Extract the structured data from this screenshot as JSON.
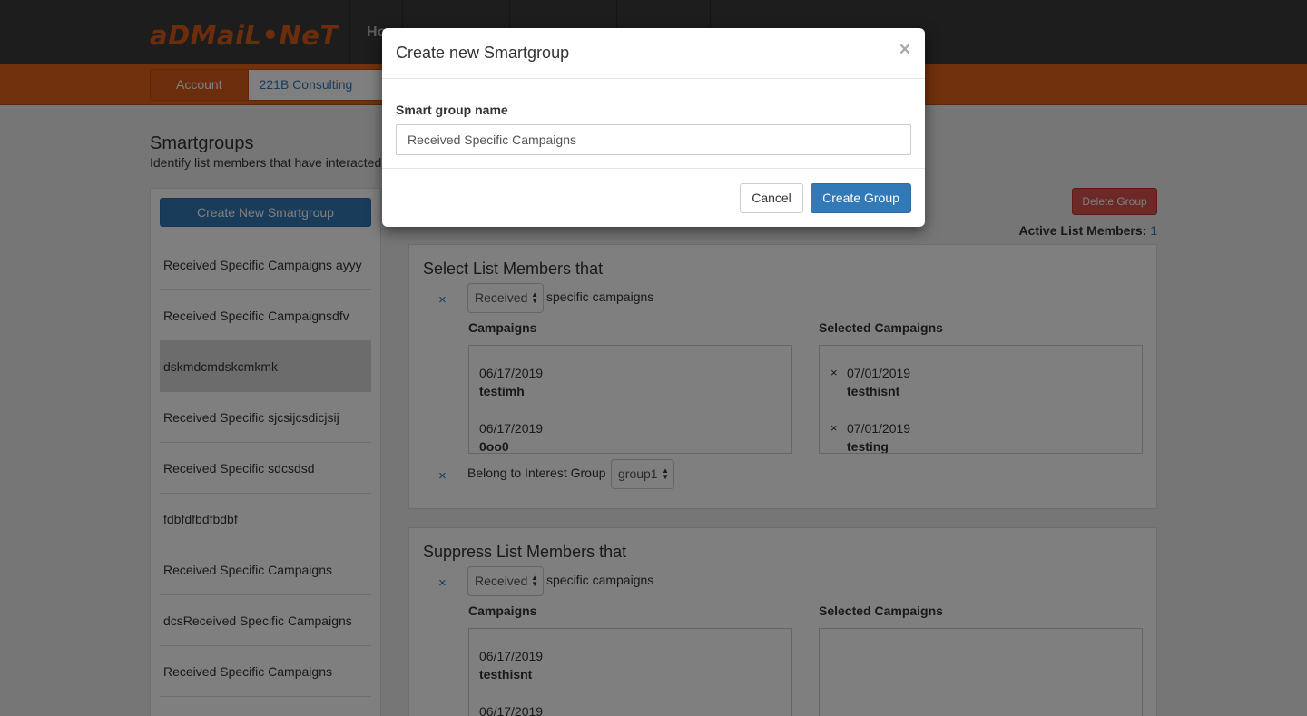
{
  "header": {
    "logo_text": "aDMaiL•NeT",
    "nav_partial": "Ho"
  },
  "account_bar": {
    "account_tab": "Account",
    "account_name": "221B Consulting"
  },
  "page": {
    "title": "Smartgroups",
    "subtitle": "Identify list members that have interacted"
  },
  "sidebar": {
    "create_button": "Create New Smartgroup",
    "items": [
      "Received Specific Campaigns ayyy",
      "Received Specific Campaignsdfv",
      "dskmdcmdskcmkmk",
      "Received Specific sjcsijcsdicjsij",
      "Received Specific sdcsdsd",
      "fdbfdfbdfbdbf",
      "Received Specific Campaigns",
      "dcsReceived Specific Campaigns",
      "Received Specific Campaigns",
      "Received Specific Campaigns"
    ],
    "active_index": 2
  },
  "toolbar": {
    "delete_button": "Delete Group",
    "active_members_label": "Active List Members:",
    "active_members_count": "1"
  },
  "select_panel": {
    "title": "Select List Members that",
    "condition_select": "Received",
    "condition_suffix": "specific campaigns",
    "campaigns_header": "Campaigns",
    "selected_header": "Selected Campaigns",
    "campaigns": [
      {
        "date": "06/17/2019",
        "name": "testimh"
      },
      {
        "date": "06/17/2019",
        "name": "0oo0"
      }
    ],
    "selected": [
      {
        "date": "07/01/2019",
        "name": "testhisnt"
      },
      {
        "date": "07/01/2019",
        "name": "testing"
      }
    ],
    "interest_label": "Belong to Interest Group",
    "interest_select": "group1"
  },
  "suppress_panel": {
    "title": "Suppress List Members that",
    "condition_select": "Received",
    "condition_suffix": "specific campaigns",
    "campaigns_header": "Campaigns",
    "selected_header": "Selected Campaigns",
    "campaigns": [
      {
        "date": "06/17/2019",
        "name": "testhisnt"
      },
      {
        "date": "06/17/2019",
        "name": ""
      }
    ]
  },
  "modal": {
    "title": "Create new Smartgroup",
    "close_glyph": "×",
    "field_label": "Smart group name",
    "field_value": "Received Specific Campaigns",
    "cancel_button": "Cancel",
    "create_button": "Create Group"
  },
  "glyphs": {
    "remove": "×",
    "updown": "▲▼"
  },
  "colors": {
    "brand_orange": "#e3631a",
    "primary_blue": "#3279b7",
    "danger_red": "#d9534f",
    "topbar_dark": "#3a3a3a"
  }
}
